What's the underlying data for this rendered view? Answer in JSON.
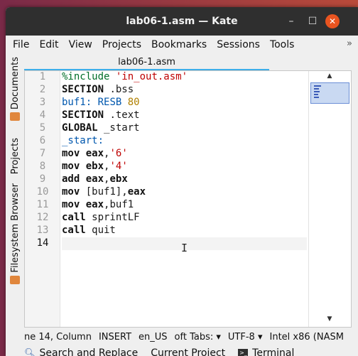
{
  "window": {
    "title": "lab06-1.asm — Kate"
  },
  "menu": [
    "File",
    "Edit",
    "View",
    "Projects",
    "Bookmarks",
    "Sessions",
    "Tools"
  ],
  "menu_more": "»",
  "sidebar": {
    "documents": "Documents",
    "projects": "Projects",
    "filesystem": "Filesystem Browser"
  },
  "tab": {
    "label": "lab06-1.asm"
  },
  "editor": {
    "lines": [
      "1",
      "2",
      "3",
      "4",
      "5",
      "6",
      "7",
      "8",
      "9",
      "10",
      "11",
      "12",
      "13",
      "14"
    ],
    "current_line": "14"
  },
  "status": {
    "position": "ne 14, Column",
    "mode": "INSERT",
    "lang": "en_US",
    "tabs": "oft Tabs:",
    "encoding": "UTF-8",
    "syntax": "Intel x86 (NASM"
  },
  "bottom": {
    "search": "Search and Replace",
    "project": "Current Project",
    "terminal": "Terminal"
  },
  "colors": {
    "titlebar": "#2f2f2f",
    "close": "#e95420",
    "tab_accent": "#3daee9",
    "directive": "#006e28",
    "string": "#bf0303",
    "keyword": "#0057ae"
  },
  "icons": {
    "search": "search-icon",
    "terminal": "terminal-icon"
  }
}
